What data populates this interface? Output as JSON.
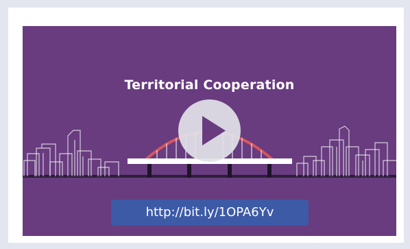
{
  "video": {
    "title": "Territorial Cooperation",
    "link_text": "http://bit.ly/1OPA6Yv",
    "play_icon": "play-icon"
  },
  "colors": {
    "page_background": "#e3e5ef",
    "card": "#ffffff",
    "video_background": "#683c7f",
    "arch": "#d9555e",
    "link_pill": "#3c5aa6",
    "play_button": "#e1e1e8"
  }
}
